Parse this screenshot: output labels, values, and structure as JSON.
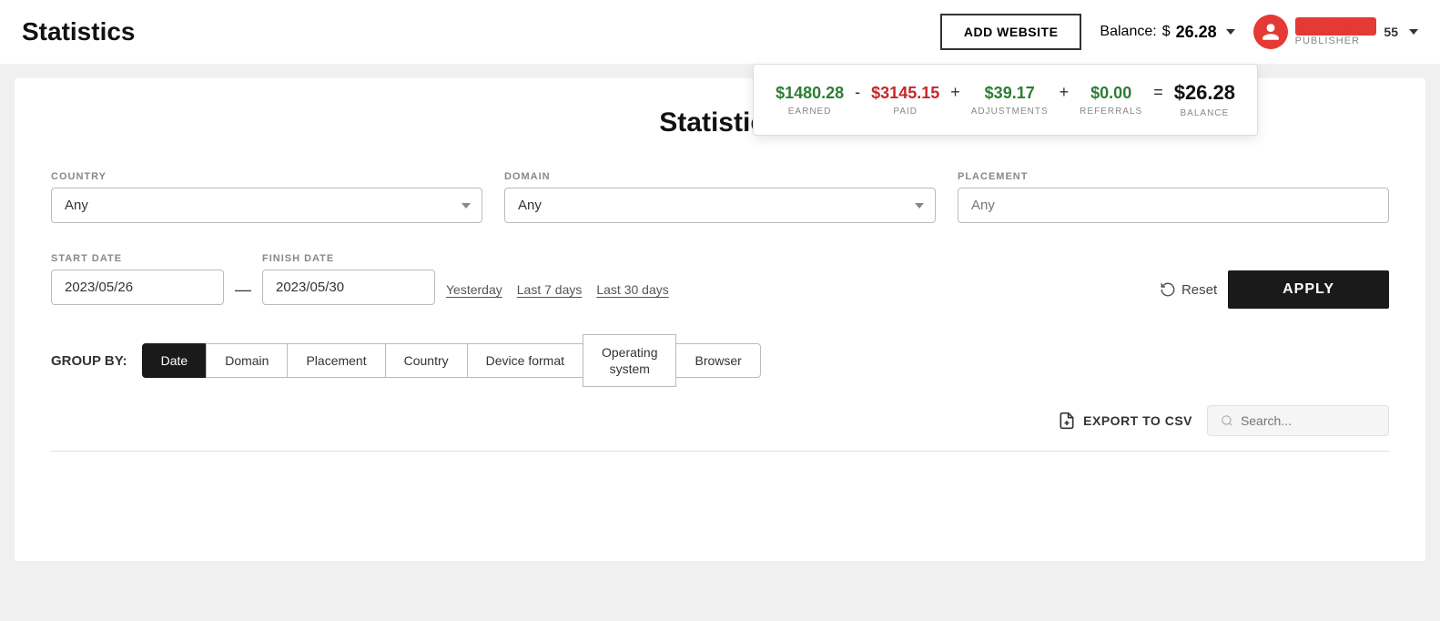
{
  "header": {
    "title": "Statistics",
    "add_website_label": "ADD WEBSITE",
    "balance_label": "Balance:",
    "balance_currency": "$",
    "balance_amount": "26.28",
    "user_number": "55",
    "publisher_label": "PUBLISHER"
  },
  "balance_popup": {
    "earned_value": "$1480.28",
    "earned_label": "EARNED",
    "paid_value": "$3145.15",
    "paid_label": "PAID",
    "adjustments_value": "$39.17",
    "adjustments_label": "ADJUSTMENTS",
    "referrals_value": "$0.00",
    "referrals_label": "REFERRALS",
    "balance_value": "$26.28",
    "balance_label": "BALANCE"
  },
  "main": {
    "heading": "Statistics",
    "filters": {
      "country_label": "COUNTRY",
      "country_value": "Any",
      "domain_label": "DOMAIN",
      "domain_value": "Any",
      "placement_label": "PLACEMENT",
      "placement_placeholder": "Any"
    },
    "dates": {
      "start_label": "START DATE",
      "start_value": "2023/05/26",
      "finish_label": "FINISH DATE",
      "finish_value": "2023/05/30",
      "yesterday_label": "Yesterday",
      "last7_label": "Last 7 days",
      "last30_label": "Last 30 days",
      "reset_label": "Reset",
      "apply_label": "APPLY"
    },
    "group_by": {
      "label": "GROUP BY:",
      "buttons": [
        {
          "id": "date",
          "label": "Date",
          "active": true
        },
        {
          "id": "domain",
          "label": "Domain",
          "active": false
        },
        {
          "id": "placement",
          "label": "Placement",
          "active": false
        },
        {
          "id": "country",
          "label": "Country",
          "active": false
        },
        {
          "id": "device-format",
          "label": "Device format",
          "active": false
        },
        {
          "id": "operating-system",
          "label": "Operating system",
          "active": false
        },
        {
          "id": "browser",
          "label": "Browser",
          "active": false
        }
      ]
    },
    "export_label": "EXPORT TO CSV",
    "search_placeholder": "Search..."
  }
}
